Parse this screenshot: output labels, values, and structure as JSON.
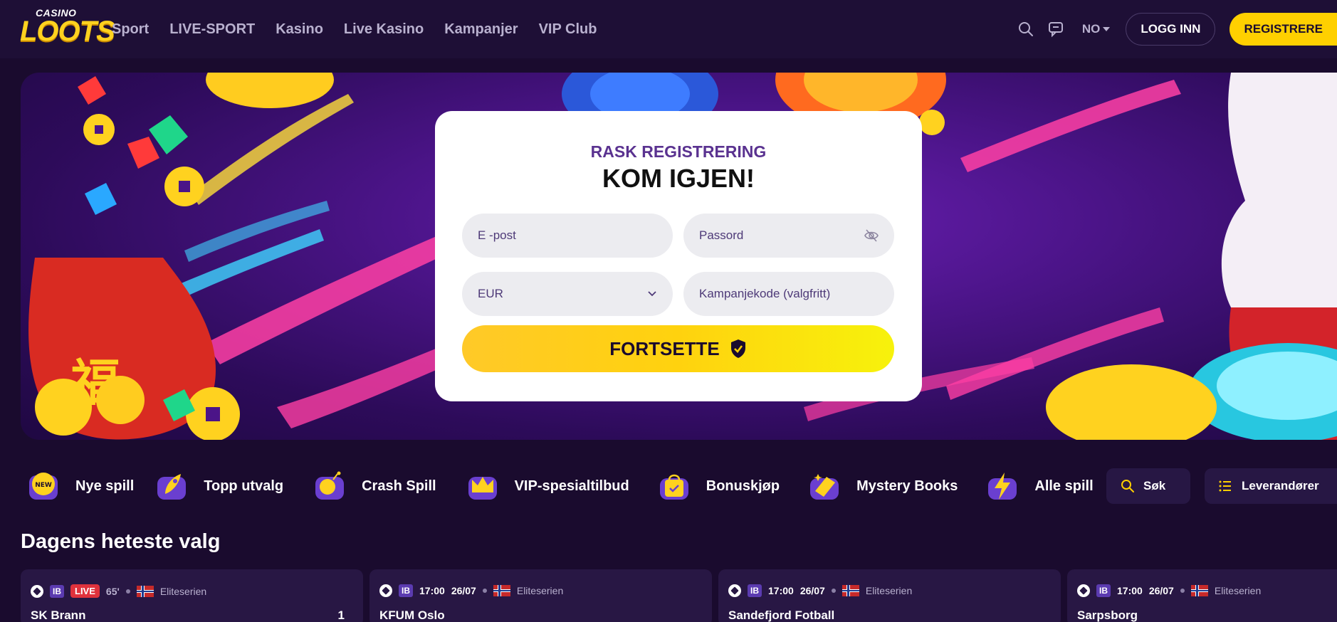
{
  "header": {
    "logo_small": "CASINO",
    "logo_big": "LOOTS",
    "nav": [
      "Sport",
      "LIVE-SPORT",
      "Kasino",
      "Live Kasino",
      "Kampanjer",
      "VIP Club"
    ],
    "lang": "NO",
    "login": "LOGG INN",
    "register": "REGISTRERE",
    "icons": [
      "search-icon",
      "chat-icon"
    ]
  },
  "form": {
    "subtitle": "RASK REGISTRERING",
    "title": "KOM IGJEN!",
    "email_placeholder": "E -post",
    "password_placeholder": "Passord",
    "currency": "EUR",
    "promo_placeholder": "Kampanjekode (valgfritt)",
    "continue": "FORTSETTE"
  },
  "categories": [
    {
      "label": "Nye spill",
      "icon": "new-badge-icon"
    },
    {
      "label": "Topp utvalg",
      "icon": "rocket-icon"
    },
    {
      "label": "Crash Spill",
      "icon": "bomb-icon"
    },
    {
      "label": "VIP-spesialtilbud",
      "icon": "crown-icon"
    },
    {
      "label": "Bonuskjøp",
      "icon": "shopping-bag-icon"
    },
    {
      "label": "Mystery Books",
      "icon": "book-icon"
    },
    {
      "label": "Alle spill",
      "icon": "lightning-icon"
    }
  ],
  "search_label": "Søk",
  "providers_label": "Leverandører",
  "section_title": "Dagens heteste valg",
  "matches": [
    {
      "ib": "IB",
      "live": "LIVE",
      "minute": "65'",
      "league": "Eliteserien",
      "team": "SK Brann",
      "score": "1"
    },
    {
      "ib": "IB",
      "time": "17:00",
      "date": "26/07",
      "league": "Eliteserien",
      "team": "KFUM Oslo"
    },
    {
      "ib": "IB",
      "time": "17:00",
      "date": "26/07",
      "league": "Eliteserien",
      "team": "Sandefjord Fotball"
    },
    {
      "ib": "IB",
      "time": "17:00",
      "date": "26/07",
      "league": "Eliteserien",
      "team": "Sarpsborg"
    }
  ],
  "colors": {
    "accent": "#ffd000",
    "bg": "#1a0b2e",
    "card": "#281744",
    "live": "#e0323c"
  }
}
